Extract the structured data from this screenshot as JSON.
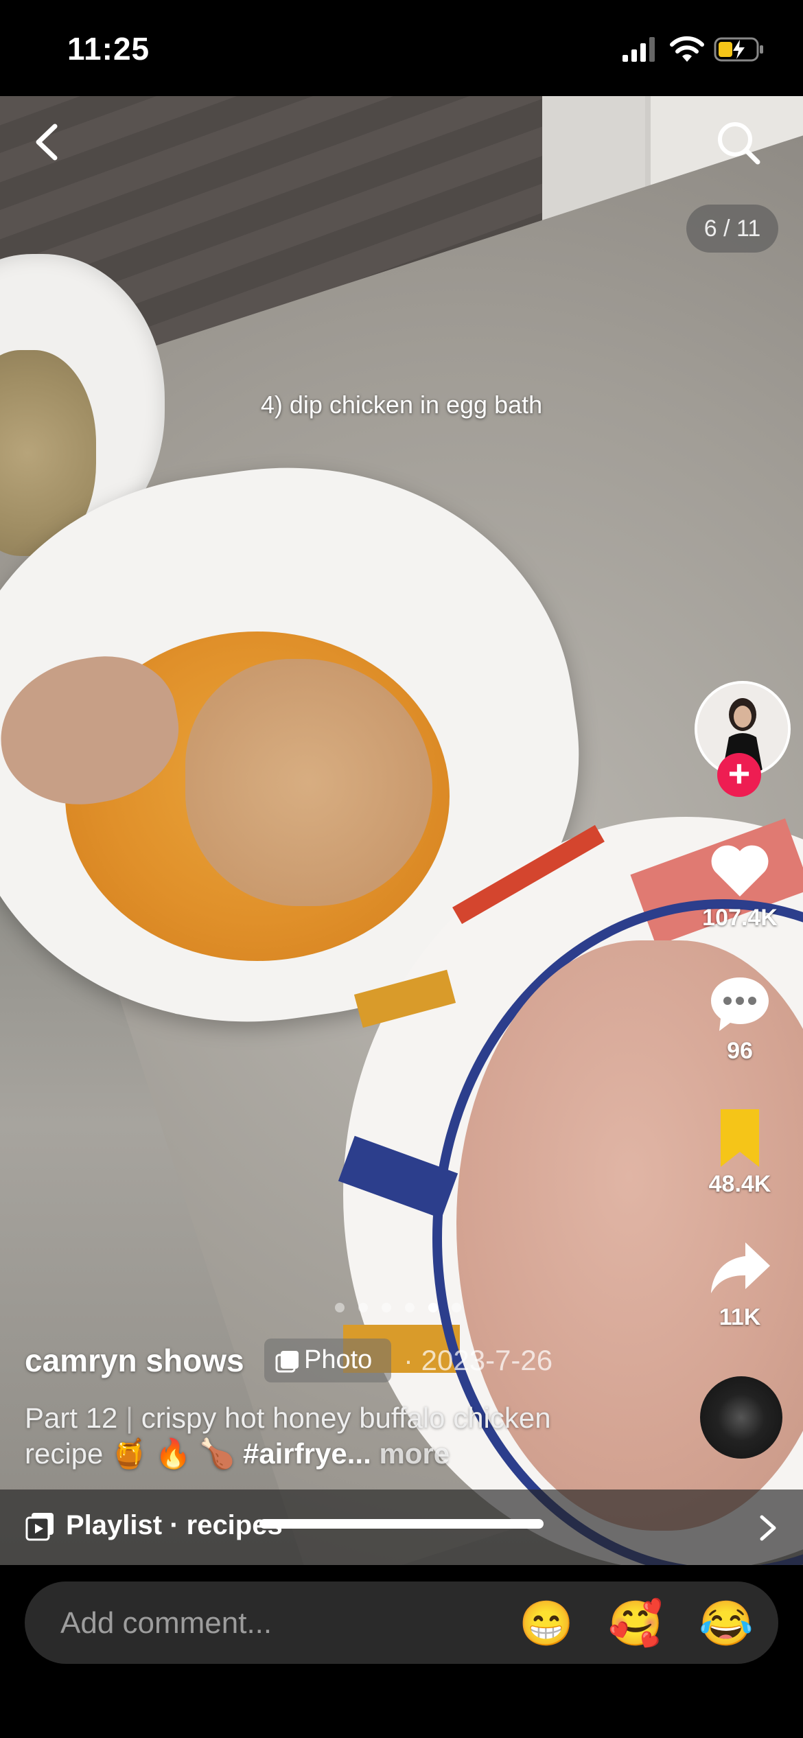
{
  "status_bar": {
    "time": "11:25"
  },
  "post": {
    "caption": "4) dip chicken in egg bath",
    "counter": "6 / 11",
    "author": "camryn shows",
    "type_label": "Photo",
    "date": "· 2023-7-26",
    "part": "Part 12",
    "separator": "|",
    "description": "crispy hot honey buffalo chicken recipe 🍯 🔥 🍗",
    "hashtag": "#airfrye...",
    "more": "more",
    "carousel": {
      "total_visible_dots": 6,
      "active_index": 4
    }
  },
  "actions": {
    "likes": "107.4K",
    "comments": "96",
    "saves": "48.4K",
    "shares": "11K"
  },
  "playlist": {
    "label": "Playlist · recipes"
  },
  "comment_bar": {
    "placeholder": "Add comment...",
    "emojis": [
      "😁",
      "🥰",
      "😂"
    ]
  },
  "icons": {
    "back": "chevron-left-icon",
    "search": "search-icon",
    "like": "heart-icon",
    "comment": "speech-bubble-icon",
    "save": "bookmark-icon",
    "share": "share-arrow-icon",
    "follow": "plus-icon",
    "playlist": "playlist-icon"
  },
  "colors": {
    "accent": "#ee1d52",
    "bookmark": "#f5c518",
    "bar": "#000000"
  }
}
